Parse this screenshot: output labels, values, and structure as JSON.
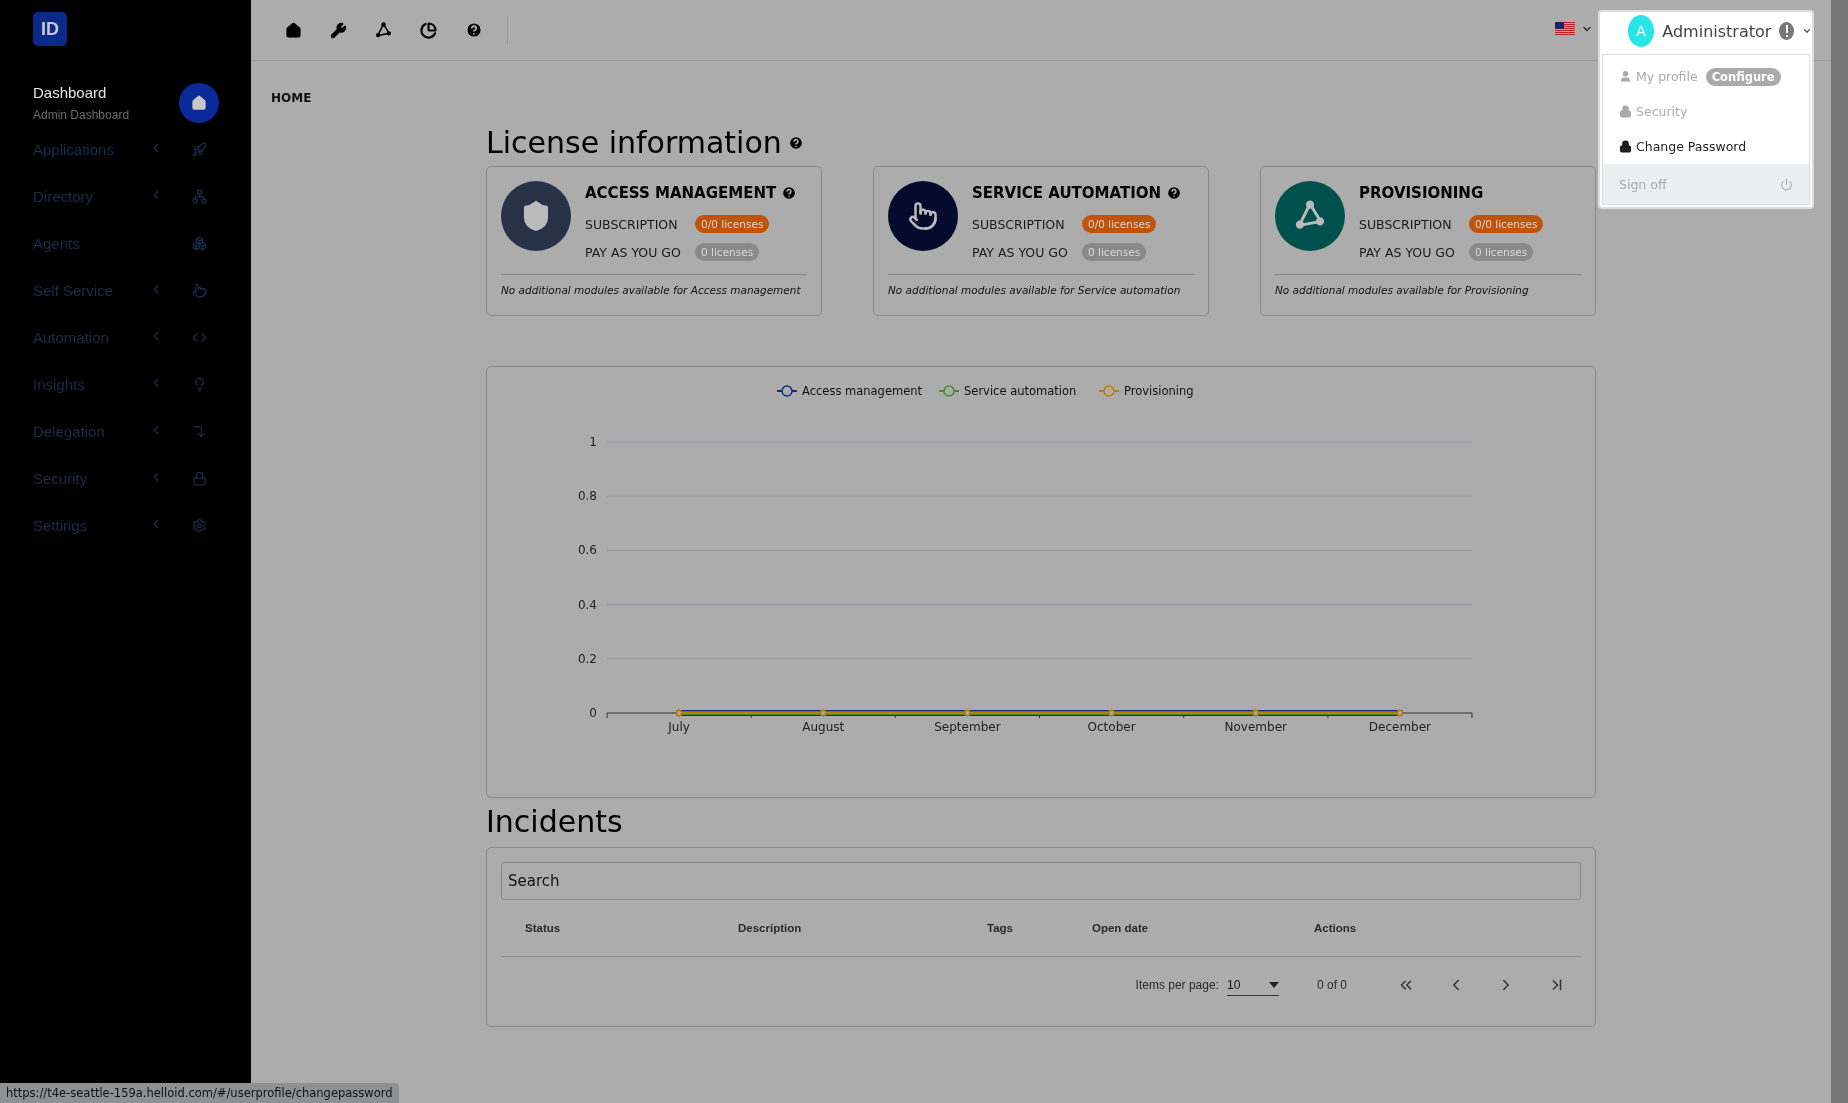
{
  "logo": {
    "text": "ID"
  },
  "sidebar": {
    "items": [
      {
        "label": "Dashboard",
        "subtitle": "Admin Dashboard",
        "selected": true,
        "has_submenu": false
      },
      {
        "label": "Applications",
        "selected": false,
        "has_submenu": true
      },
      {
        "label": "Directory",
        "selected": false,
        "has_submenu": true
      },
      {
        "label": "Agents",
        "selected": false,
        "has_submenu": false
      },
      {
        "label": "Self Service",
        "selected": false,
        "has_submenu": true
      },
      {
        "label": "Automation",
        "selected": false,
        "has_submenu": true
      },
      {
        "label": "Insights",
        "selected": false,
        "has_submenu": true
      },
      {
        "label": "Delegation",
        "selected": false,
        "has_submenu": true
      },
      {
        "label": "Security",
        "selected": false,
        "has_submenu": true
      },
      {
        "label": "Settings",
        "selected": false,
        "has_submenu": true
      }
    ]
  },
  "user": {
    "avatar_letter": "A",
    "name": "Administrator"
  },
  "user_menu": {
    "items": [
      {
        "label": "My profile",
        "badge": "Configure",
        "disabled": true
      },
      {
        "label": "Security",
        "disabled": true
      },
      {
        "label": "Change Password",
        "disabled": false
      }
    ],
    "footer": "Sign off"
  },
  "breadcrumb": "HOME",
  "license": {
    "title": "License information",
    "cards": [
      {
        "title": "ACCESS MANAGEMENT",
        "help": true,
        "color": "#283246",
        "subscription_label": "SUBSCRIPTION",
        "subscription": "0/0 licenses",
        "payg_label": "PAY AS YOU GO",
        "payg": "0 licenses",
        "note": "No additional modules available for Access management"
      },
      {
        "title": "SERVICE AUTOMATION",
        "help": true,
        "color": "#060a2c",
        "subscription_label": "SUBSCRIPTION",
        "subscription": "0/0 licenses",
        "payg_label": "PAY AS YOU GO",
        "payg": "0 licenses",
        "note": "No additional modules available for Service automation"
      },
      {
        "title": "PROVISIONING",
        "help": false,
        "color": "#00504e",
        "subscription_label": "SUBSCRIPTION",
        "subscription": "0/0 licenses",
        "payg_label": "PAY AS YOU GO",
        "payg": "0 licenses",
        "note": "No additional modules available for Provisioning"
      }
    ]
  },
  "chart_data": {
    "type": "line",
    "categories": [
      "July",
      "August",
      "September",
      "October",
      "November",
      "December"
    ],
    "series": [
      {
        "name": "Access management",
        "color": "#1a2a80",
        "marker": "circle",
        "values": [
          0,
          0,
          0,
          0,
          0,
          0
        ]
      },
      {
        "name": "Service automation",
        "color": "#4a8a2a",
        "marker": "circle",
        "values": [
          0,
          0,
          0,
          0,
          0,
          0
        ]
      },
      {
        "name": "Provisioning",
        "color": "#c07a10",
        "marker": "circle",
        "values": [
          0,
          0,
          0,
          0,
          0,
          0
        ]
      }
    ],
    "ylim": [
      0,
      1
    ],
    "yticks": [
      0,
      0.2,
      0.4,
      0.6,
      0.8,
      1
    ],
    "grid": true,
    "legend": true
  },
  "incidents": {
    "title": "Incidents",
    "search_placeholder": "Search",
    "columns": [
      "Status",
      "Description",
      "Tags",
      "Open date",
      "Actions"
    ],
    "items_per_page_label": "Items per page:",
    "items_per_page": "10",
    "range": "0 of 0"
  },
  "status_url": "https://t4e-seattle-159a.helloid.com/#/userprofile/changepassword"
}
